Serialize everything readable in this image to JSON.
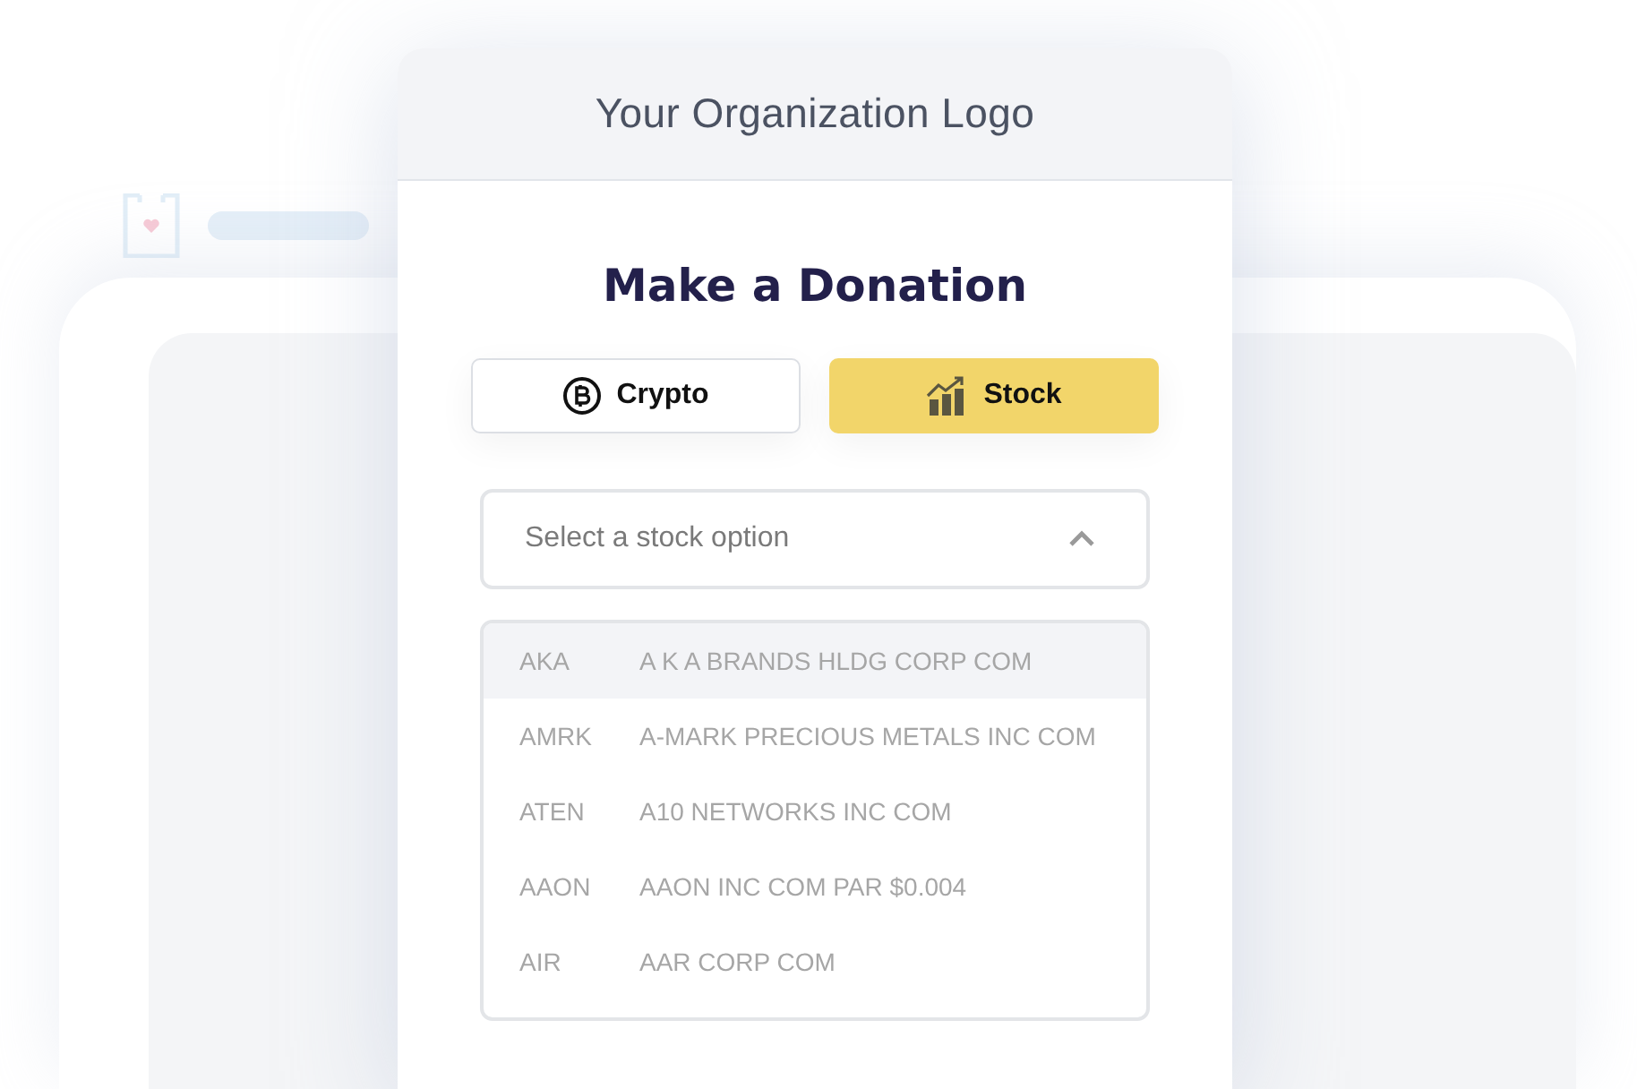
{
  "header": {
    "title": "Your Organization Logo"
  },
  "heading": "Make a Donation",
  "tabs": [
    {
      "label": "Crypto",
      "kind": "crypto",
      "selected": false
    },
    {
      "label": "Stock",
      "kind": "stock",
      "selected": true
    }
  ],
  "select": {
    "placeholder": "Select a stock option",
    "expanded": true
  },
  "options": [
    {
      "symbol": "AKA",
      "name": "A K A BRANDS HLDG CORP COM",
      "selected": true
    },
    {
      "symbol": "AMRK",
      "name": "A-MARK PRECIOUS METALS INC COM",
      "selected": false
    },
    {
      "symbol": "ATEN",
      "name": "A10 NETWORKS INC COM",
      "selected": false
    },
    {
      "symbol": "AAON",
      "name": "AAON INC COM PAR $0.004",
      "selected": false
    },
    {
      "symbol": "AIR",
      "name": "AAR CORP COM",
      "selected": false
    }
  ]
}
